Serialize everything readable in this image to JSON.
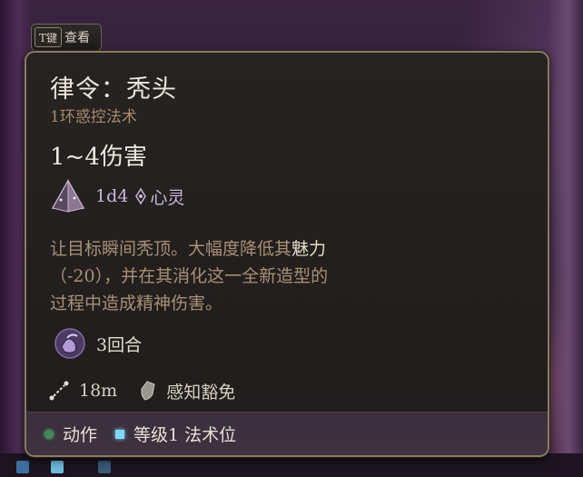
{
  "hint": {
    "key": "T键",
    "label": "查看"
  },
  "spell": {
    "name": "律令：秃头",
    "level_school": "1环惑控法术",
    "damage": "1~4伤害",
    "dice": "1d4",
    "damage_type": "心灵",
    "description_prefix": "让目标瞬间秃顶。大幅度降低其",
    "description_highlight": "魅力",
    "description_line2": "（-20），并在其消化这一全新造型的",
    "description_line3": "过程中造成精神伤害。",
    "duration": "3回合",
    "range": "18m",
    "save": "感知豁免"
  },
  "footer": {
    "action_label": "动作",
    "slot_label": "等级1 法术位"
  },
  "colors": {
    "border": "#8a7a63",
    "subtitle": "#a58a6d",
    "dice_text": "#c9b7d8",
    "action_dot": "#3f8a55",
    "slot_square": "#7fd7ff"
  }
}
